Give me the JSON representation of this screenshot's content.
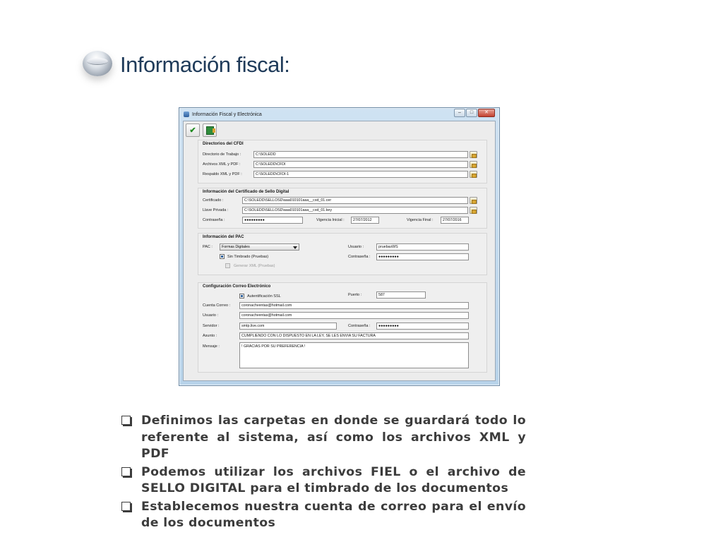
{
  "page": {
    "title": "Información fiscal:"
  },
  "window": {
    "title": "Información Fiscal y Electrónica",
    "controls": {
      "minimize": "–",
      "maximize": "□",
      "close": "✕"
    },
    "toolbar": {
      "save_icon": "check-icon",
      "export_icon": "excel-icon"
    }
  },
  "cfdi": {
    "title": "Directorios del CFDI",
    "work_dir_label": "Directorio de Trabajo :",
    "work_dir_value": "C:\\SOLEDD",
    "xml_pdf_label": "Archivos XML y PDF :",
    "xml_pdf_value": "C:\\SOLEDD\\CFDI",
    "backup_label": "Respaldo XML y PDF :",
    "backup_value": "C:\\SOLEDD\\CFDI-1"
  },
  "cert": {
    "title": "Información del Certificado de Sello Digital",
    "cert_label": "Certificado :",
    "cert_value": "C:\\SOLEDD\\SELLOSD\\aaa010101aaa__csd_01.cer",
    "key_label": "Llave Privada :",
    "key_value": "C:\\SOLEDD\\SELLOSD\\aaa010101aaa__csd_01.key",
    "pass_label": "Contraseña :",
    "pass_value": "●●●●●●●●●",
    "start_label": "Vigencia Inicial :",
    "start_value": "27/07/2012",
    "end_label": "Vigencia Final :",
    "end_value": "27/07/2016"
  },
  "pac": {
    "title": "Información del PAC",
    "pac_label": "PAC :",
    "pac_value": "Formas Digitales",
    "user_label": "Usuario :",
    "user_value": "pruebasWS",
    "pass_label": "Contraseña :",
    "pass_value": "●●●●●●●●●",
    "no_stamp_label": "Sin Timbrado (Pruebas)",
    "gen_xml_label": "Generar XML (Pruebas)"
  },
  "mail": {
    "title": "Configuración Correo Electrónico",
    "ssl_label": "Autentificación SSL",
    "port_label": "Puerto :",
    "port_value": "587",
    "account_label": "Cuenta Correo :",
    "account_value": "coronachventas@hotmail.com",
    "user_label": "Usuario :",
    "user_value": "coronachventas@hotmail.com",
    "server_label": "Servidor :",
    "server_value": "smtp.live.com",
    "pass_label": "Contraseña :",
    "pass_value": "●●●●●●●●●",
    "subject_label": "Asunto :",
    "subject_value": "CUMPLIENDO CON LO DISPUESTO EN LA LEY, SE LES ENVIA SU FACTURA",
    "message_label": "Mensaje :",
    "message_value": "! GRACIAS POR SU PREFERENCIA !"
  },
  "bullets": [
    "Definimos las carpetas en donde se guardará todo lo referente al sistema, así  como los archivos XML y PDF",
    "Podemos utilizar los archivos FIEL o el archivo de SELLO DIGITAL para el timbrado de los documentos",
    "Establecemos nuestra cuenta de correo para el envío de los documentos"
  ]
}
